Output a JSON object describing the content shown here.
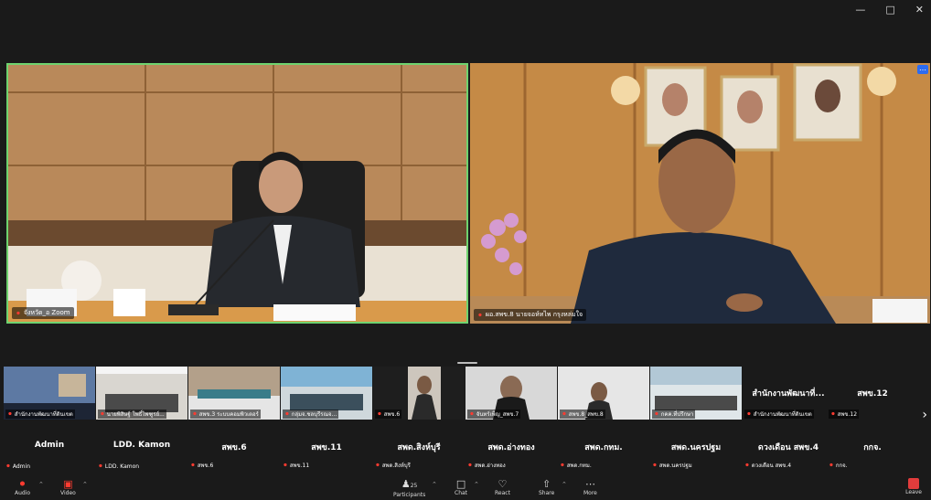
{
  "main": {
    "left_label": "จังหวัด_อ Zoom",
    "right_label": "ผอ.สพข.8 นายจอห์ทไพ กรุงหล่มใจ"
  },
  "strip": {
    "tiles": [
      {
        "label": "สำนักงานพัฒนาที่ดินเขต"
      },
      {
        "label": "นายพิสิษฐ์ โพธิ์ไพฑูรย์..."
      },
      {
        "label": "สพข.3 ระบบคอมพิวเตอร์"
      },
      {
        "label": "กลุ่มจ.ชลบุรีรณจ..."
      },
      {
        "label": "สพข.6"
      },
      {
        "label": "จันทร์เพ็ญ_สพข.7"
      },
      {
        "label": "สพข.8_สพข.8"
      },
      {
        "label": "กคค.ที่ปรึกษา"
      }
    ],
    "name_tiles": [
      {
        "big": "สำนักงานพัฒนาที่...",
        "small": "สำนักงานพัฒนาที่ดินเขต"
      },
      {
        "big": "สพข.12",
        "small": "สพข.12"
      }
    ]
  },
  "row2": [
    {
      "big": "Admin",
      "small": "Admin"
    },
    {
      "big": "LDD. Kamon",
      "small": "LDD. Kamon"
    },
    {
      "big": "สพข.6",
      "small": "สพข.6"
    },
    {
      "big": "สพข.11",
      "small": "สพข.11"
    },
    {
      "big": "สพด.สิงห์บุรี",
      "small": "สพด.สิงห์บุรี"
    },
    {
      "big": "สพด.อ่างทอง",
      "small": "สพด.อ่างทอง"
    },
    {
      "big": "สพด.กทม.",
      "small": "สพด.กทม."
    },
    {
      "big": "สพด.นครปฐม",
      "small": "สพด.นครปฐม"
    },
    {
      "big": "ดวงเดือน สพข.4",
      "small": "ดวงเดือน สพข.4"
    },
    {
      "big": "กกจ.",
      "small": "กกจ."
    }
  ],
  "toolbar": {
    "audio": "Audio",
    "video": "Video",
    "participants": "Participants",
    "participants_count": "25",
    "chat": "Chat",
    "react": "React",
    "share": "Share",
    "more": "More",
    "leave": "Leave"
  }
}
